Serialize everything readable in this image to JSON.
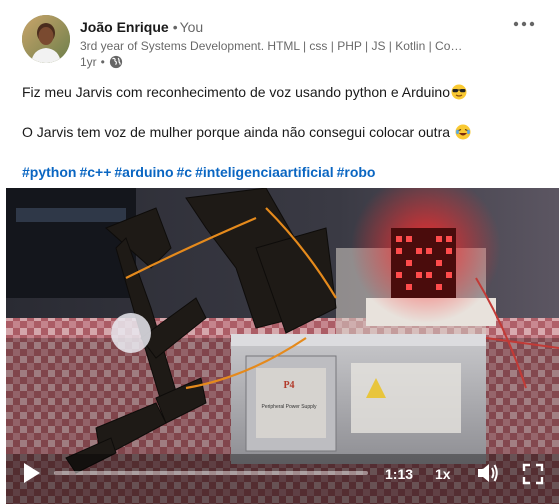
{
  "author": {
    "name": "João Enrique",
    "relation": "You",
    "headline": "3rd year of Systems Development. HTML | css | PHP | JS | Kotlin | Compo...",
    "age": "1yr",
    "visibility_icon": "globe-icon"
  },
  "post": {
    "line1": "Fiz meu Jarvis com reconhecimento de voz usando python e Arduino",
    "line1_emoji": "sunglasses-emoji",
    "line2": "O Jarvis tem voz de mulher porque ainda não consegui colocar outra",
    "line2_emoji": "laughing-emoji",
    "hashtags": [
      "#python",
      "#c++",
      "#arduino",
      "#c",
      "#inteligenciaartificial",
      "#robo"
    ]
  },
  "video": {
    "duration": "1:13",
    "speed": "1x",
    "progress": 0.0,
    "screen_text": "Peripheral Power Supply"
  },
  "colors": {
    "link": "#0a66c2",
    "text": "#000000e6",
    "muted": "#00000099"
  }
}
